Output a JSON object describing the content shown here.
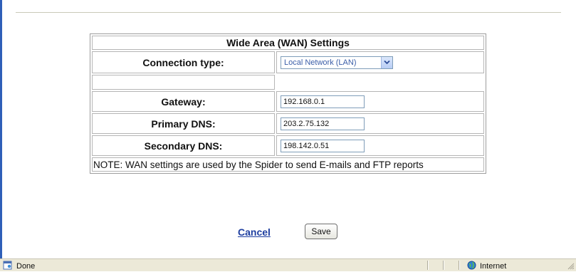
{
  "form": {
    "title": "Wide Area (WAN) Settings",
    "connection_type": {
      "label": "Connection type:",
      "selected": "Local Network (LAN)"
    },
    "gateway": {
      "label": "Gateway:",
      "value": "192.168.0.1"
    },
    "primary_dns": {
      "label": "Primary DNS:",
      "value": "203.2.75.132"
    },
    "secondary_dns": {
      "label": "Secondary DNS:",
      "value": "198.142.0.51"
    },
    "note": "NOTE: WAN settings are used by the Spider to send E-mails and FTP reports"
  },
  "actions": {
    "cancel_label": "Cancel",
    "save_label": "Save"
  },
  "status_bar": {
    "left_text": "Done",
    "zone_text": "Internet"
  },
  "icons": {
    "status_page": "page-icon",
    "zone": "globe-icon",
    "dropdown": "chevron-down-icon"
  }
}
